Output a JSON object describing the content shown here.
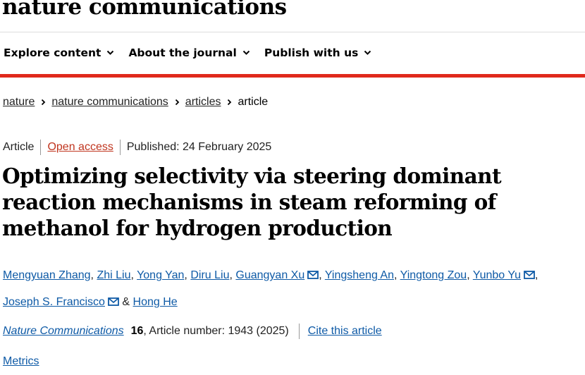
{
  "site": {
    "logo": "nature communications"
  },
  "nav": {
    "items": [
      {
        "label": "Explore content"
      },
      {
        "label": "About the journal"
      },
      {
        "label": "Publish with us"
      }
    ]
  },
  "breadcrumb": {
    "links": [
      "nature",
      "nature communications",
      "articles"
    ],
    "current": "article"
  },
  "article": {
    "type": "Article",
    "access": "Open access",
    "published": "Published: 24 February 2025",
    "title": "Optimizing selectivity via steering dominant reaction mechanisms in steam reforming of methanol for hydrogen production",
    "authors": {
      "a0": "Mengyuan Zhang",
      "a1": "Zhi Liu",
      "a2": "Yong Yan",
      "a3": "Diru Liu",
      "a4": "Guangyan Xu",
      "a5": "Yingsheng An",
      "a6": "Yingtong Zou",
      "a7": "Yunbo Yu",
      "a8": "Joseph S. Francisco",
      "a9": "Hong He",
      "comma": ",",
      "amp": "&"
    },
    "journal": "Nature Communications",
    "volume": "16",
    "article_number": ", Article number: 1943 (2025)",
    "cite": "Cite this article",
    "metrics": "Metrics"
  },
  "colors": {
    "accent_red": "#e0291c",
    "link_blue": "#0e5aa6",
    "open_access": "#c0351f"
  },
  "icons": {
    "nav_chevron": "chevron-down-icon",
    "breadcrumb_sep": "chevron-right-icon",
    "author_contact": "mail-icon"
  }
}
